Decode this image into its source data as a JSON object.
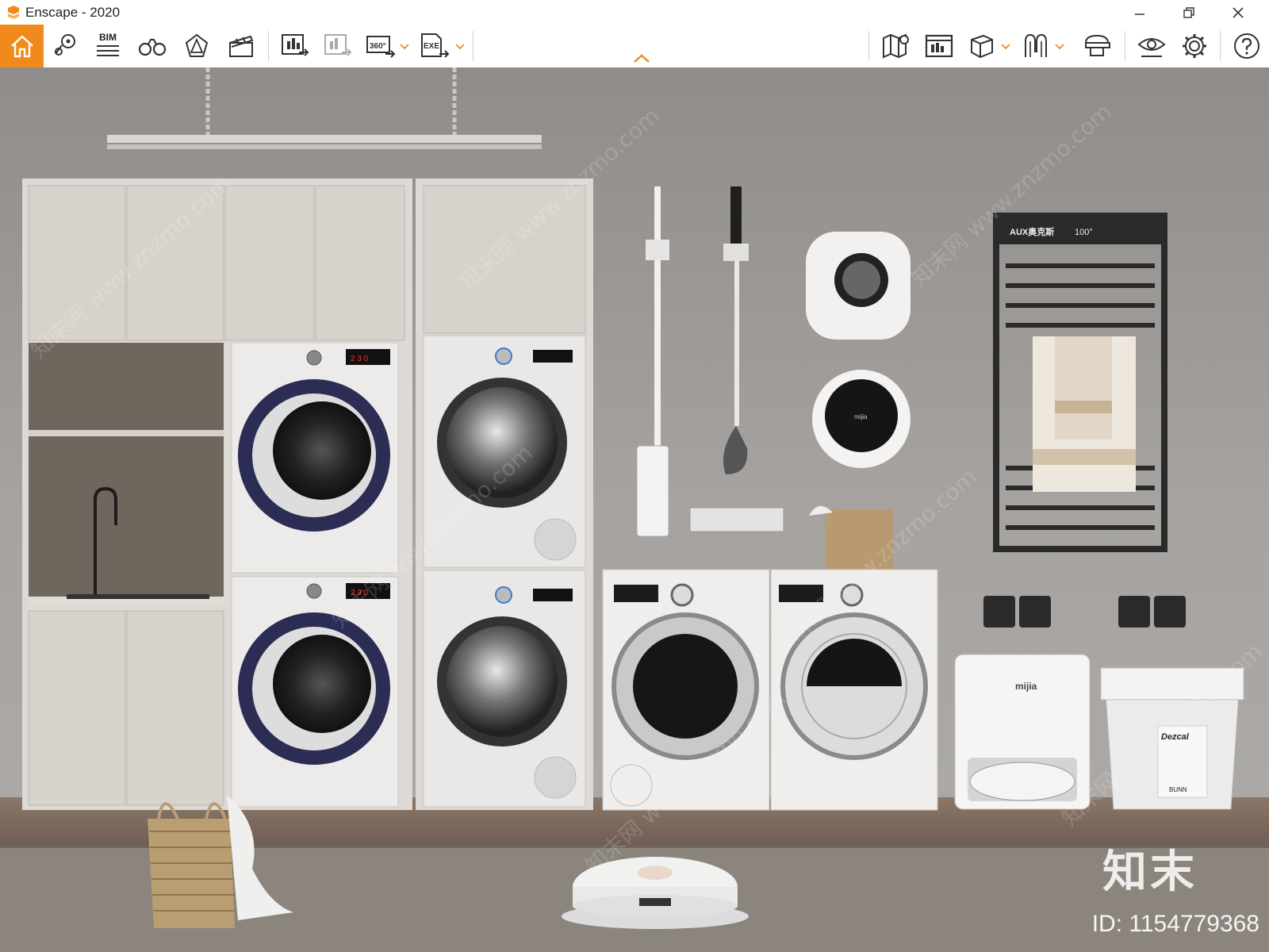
{
  "window": {
    "title": "Enscape - 2020"
  },
  "toolbar": {
    "bim_label": "BIM",
    "panorama_label": "360°",
    "exe_label": "EXE",
    "buttons": [
      {
        "name": "home-icon"
      },
      {
        "name": "views-icon"
      },
      {
        "name": "bim-icon"
      },
      {
        "name": "binoculars-icon"
      },
      {
        "name": "light-icon"
      },
      {
        "name": "clapper-icon"
      },
      {
        "name": "render-export-icon"
      },
      {
        "name": "batch-render-icon"
      },
      {
        "name": "panorama-360-icon"
      },
      {
        "name": "exe-export-icon"
      },
      {
        "name": "map-icon"
      },
      {
        "name": "screenshot-icon"
      },
      {
        "name": "asset-cube-icon"
      },
      {
        "name": "vr-headset-icon"
      },
      {
        "name": "hat-icon"
      },
      {
        "name": "visual-settings-icon"
      },
      {
        "name": "settings-gear-icon"
      },
      {
        "name": "help-icon"
      }
    ]
  },
  "scene": {
    "radiator_brand": "AUX奥克斯",
    "radiator_temp": "100°",
    "washer_display": "2 3 0",
    "robot_base_brand": "mijia",
    "bucket_label": "Dezcal",
    "bucket_sub": "BUNN",
    "small_washer_brand": "mijia"
  },
  "watermark": {
    "brand": "知末",
    "id_text": "ID: 1154779368",
    "diagonal_text": "知末网 www.znzmo.com"
  }
}
